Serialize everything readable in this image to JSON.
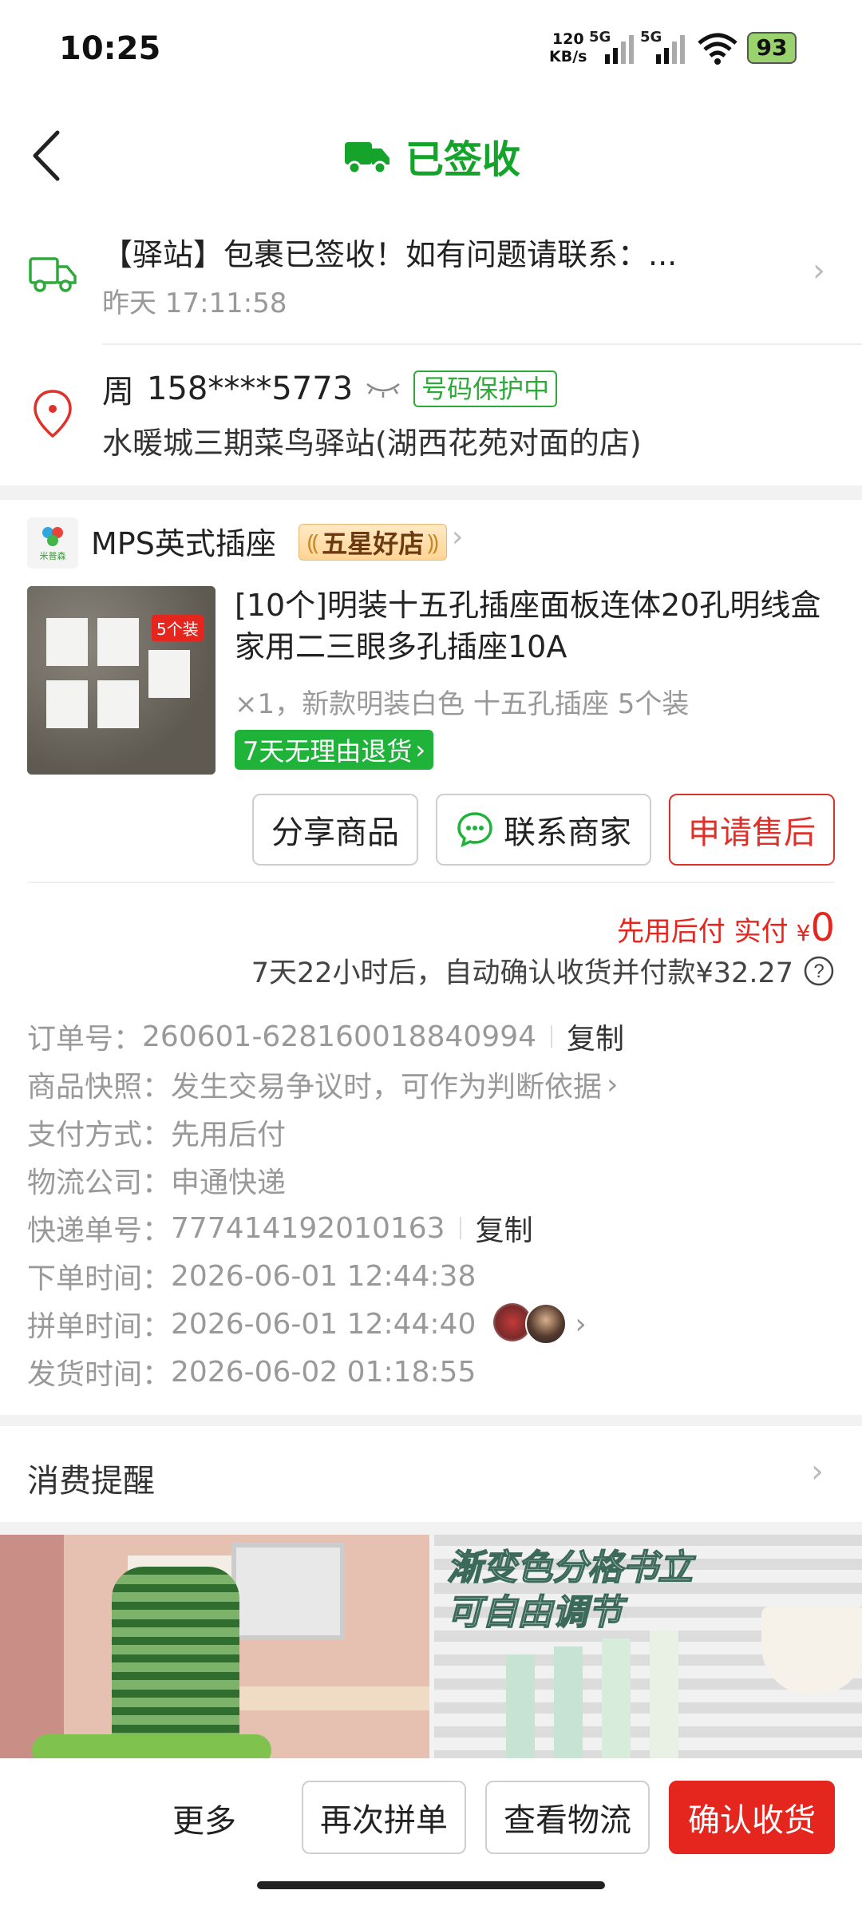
{
  "status_bar": {
    "time": "10:25",
    "net_speed": "120",
    "net_unit": "KB/s",
    "sim1": "5G",
    "sim2": "5G",
    "battery": "93"
  },
  "header": {
    "title": "已签收"
  },
  "tracking": {
    "message": "【驿站】包裹已签收！如有问题请联系：...",
    "time": "昨天 17:11:58"
  },
  "address": {
    "name": "周",
    "phone": "158****5773",
    "protect_tag": "号码保护中",
    "location": "水暖城三期菜鸟驿站(湖西花苑对面的店)"
  },
  "shop": {
    "logo_text": "米普森",
    "name": "MPS英式插座",
    "badge": "五星好店"
  },
  "product": {
    "thumb_tag": "5个装",
    "title": "[10个]明装十五孔插座面板连体20孔明线盒家用二三眼多孔插座10A",
    "spec": "×1，新款明装白色 十五孔插座 5个装",
    "return_tag": "7天无理由退货"
  },
  "actions": {
    "share": "分享商品",
    "contact": "联系商家",
    "after_sale": "申请售后"
  },
  "payment": {
    "label": "先用后付 实付",
    "currency": "¥",
    "amount": "0",
    "auto_confirm": "7天22小时后，自动确认收货并付款¥32.27"
  },
  "order_info": {
    "order_no_label": "订单号：",
    "order_no": "260601-628160018840994",
    "copy": "复制",
    "snapshot_label": "商品快照：",
    "snapshot": "发生交易争议时，可作为判断依据",
    "pay_method_label": "支付方式：",
    "pay_method": "先用后付",
    "logistics_label": "物流公司：",
    "logistics": "申通快递",
    "tracking_no_label": "快递单号：",
    "tracking_no": "777414192010163",
    "order_time_label": "下单时间：",
    "order_time": "2026-06-01 12:44:38",
    "group_time_label": "拼单时间：",
    "group_time": "2026-06-01 12:44:40",
    "ship_time_label": "发货时间：",
    "ship_time": "2026-06-02 01:18:55"
  },
  "reminder": {
    "label": "消费提醒"
  },
  "recommend": {
    "right_caption_1": "渐变色分格书立",
    "right_caption_2": "可自由调节"
  },
  "bottom_bar": {
    "more": "更多",
    "regroup": "再次拼单",
    "view_logistics": "查看物流",
    "confirm": "确认收货"
  },
  "colors": {
    "green": "#15a32b",
    "red": "#e5261f"
  }
}
